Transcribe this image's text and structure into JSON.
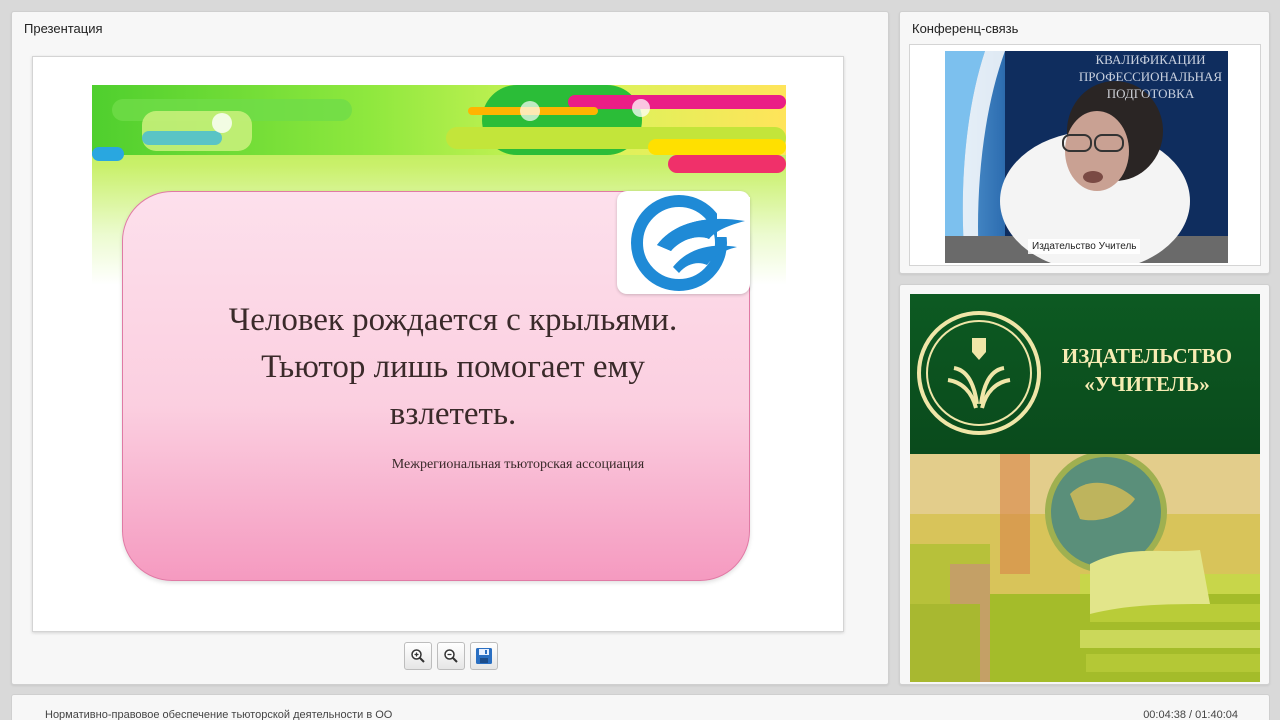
{
  "presentation": {
    "panel_title": "Презентация",
    "slide": {
      "quote": "Человек рождается с крыльями.\nТьютор лишь помогает ему\nвзлететь.",
      "attribution": "Межрегиональная тьюторская ассоциация"
    },
    "toolbar": {
      "zoom_in_icon": "zoom-in-icon",
      "zoom_out_icon": "zoom-out-icon",
      "save_icon": "save-icon"
    }
  },
  "conference": {
    "panel_title": "Конференц-связь",
    "video_caption": "Издательство Учитель",
    "background_sign": "КВАЛИФИКАЦИИ\nПРОФЕССИОНАЛЬНАЯ\nПОДГОТОВКА"
  },
  "publisher": {
    "name": "ИЗДАТЕЛЬСТВО\n«УЧИТЕЛЬ»"
  },
  "footer": {
    "title": "Нормативно-правовое обеспечение тьюторской деятельности в ОО",
    "time": "00:04:38 / 01:40:04"
  },
  "colors": {
    "slide_card": "#fbcfe0",
    "publisher_green": "#0d5a22",
    "logo_blue": "#1f8ad6"
  }
}
